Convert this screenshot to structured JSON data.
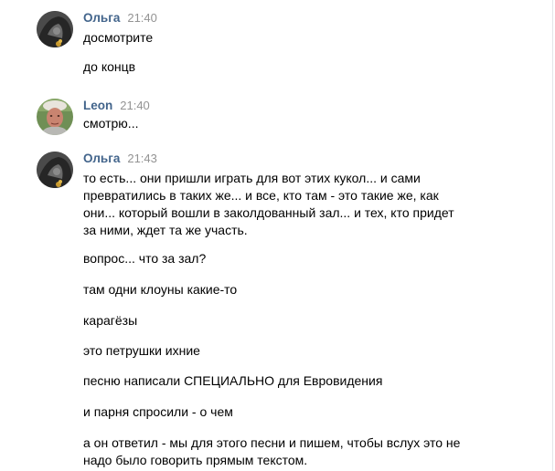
{
  "messages": [
    {
      "author": "Ольга",
      "time": "21:40",
      "avatar": "olga-avatar",
      "texts": [
        "досмотрите",
        "до концв"
      ]
    },
    {
      "author": "Leon",
      "time": "21:40",
      "avatar": "leon-avatar",
      "texts": [
        "смотрю..."
      ]
    },
    {
      "author": "Ольга",
      "time": "21:43",
      "avatar": "olga-avatar",
      "texts": [
        "то есть... они пришли играть для вот этих кукол... и сами превратились в таких же... и все, кто там - это такие же, как они... который вошли в заколдованный зал... и тех, кто придет за ними, ждет та же участь.",
        "вопрос... что за зал?",
        "там одни клоуны какие-то",
        "карагёзы",
        "это петрушки ихние",
        "песню написали СПЕЦИАЛЬНО для Евровидения",
        "и парня спросили - о чем",
        "а он ответил - мы для этого песни и пишем, чтобы вслух это не надо было говорить прямым текстом."
      ]
    }
  ],
  "colors": {
    "author": "#42648b",
    "time": "#939393",
    "text": "#000000",
    "background": "#ffffff"
  }
}
